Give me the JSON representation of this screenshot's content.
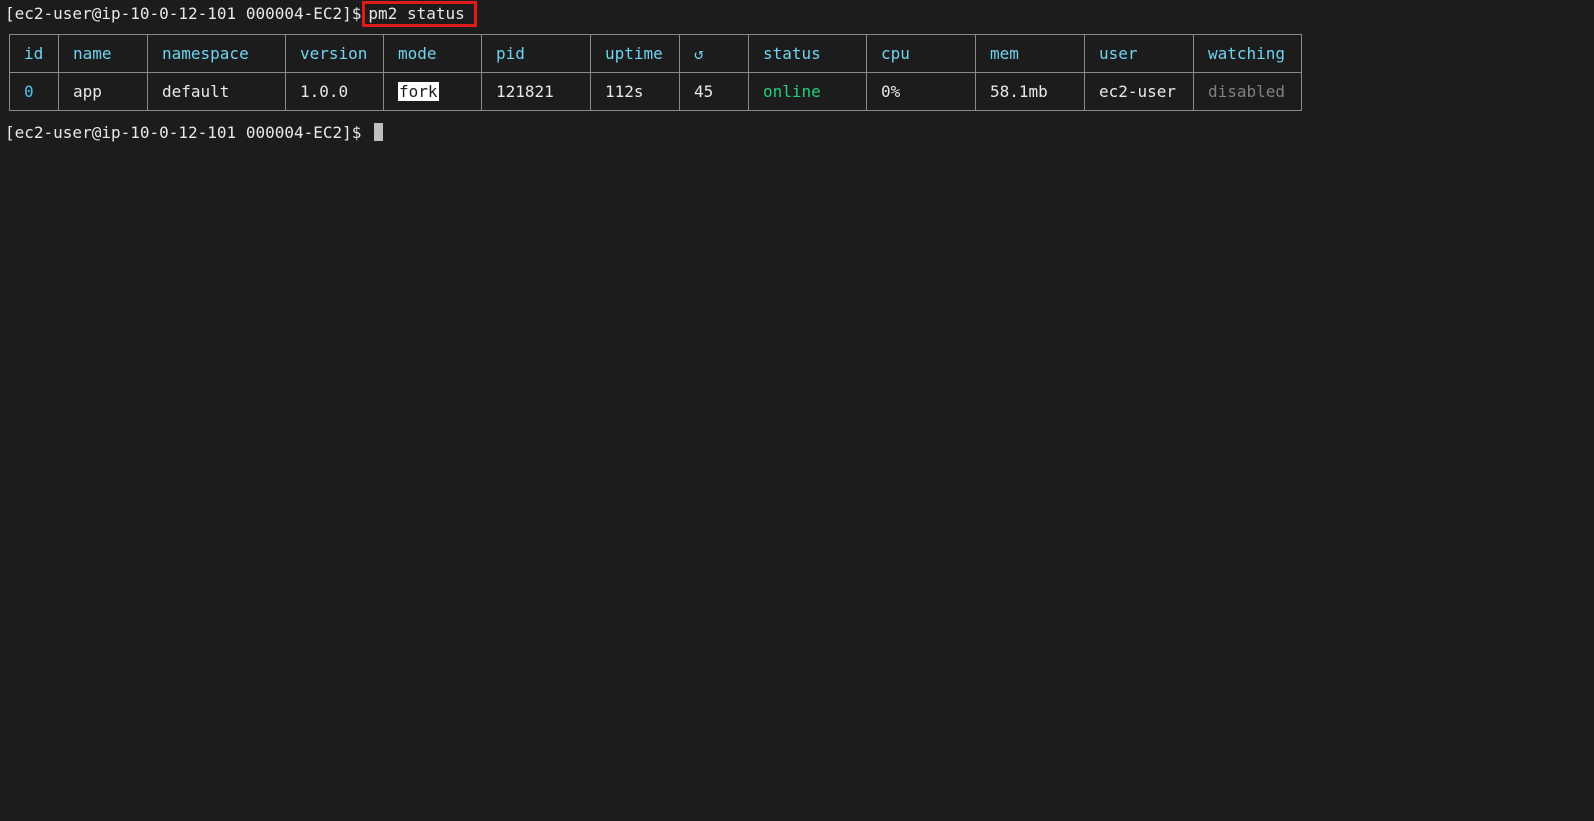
{
  "terminal": {
    "prompt": "[ec2-user@ip-10-0-12-101 000004-EC2]$",
    "command": "pm2 status",
    "prompt2": "[ec2-user@ip-10-0-12-101 000004-EC2]$ "
  },
  "table": {
    "headers": [
      "id",
      "name",
      "namespace",
      "version",
      "mode",
      "pid",
      "uptime",
      "↺",
      "status",
      "cpu",
      "mem",
      "user",
      "watching"
    ],
    "rows": [
      {
        "id": "0",
        "name": "app",
        "namespace": "default",
        "version": "1.0.0",
        "mode": "fork",
        "pid": "121821",
        "uptime": "112s",
        "restarts": "45",
        "status": "online",
        "cpu": "0%",
        "mem": "58.1mb",
        "user": "ec2-user",
        "watching": "disabled"
      }
    ]
  },
  "colors": {
    "background": "#1c1c1c",
    "header_text": "#6fd3f0",
    "id_text": "#4ec3ef",
    "status_online": "#1fd17a",
    "watching_disabled": "#808080",
    "highlight_box": "#e01919"
  }
}
